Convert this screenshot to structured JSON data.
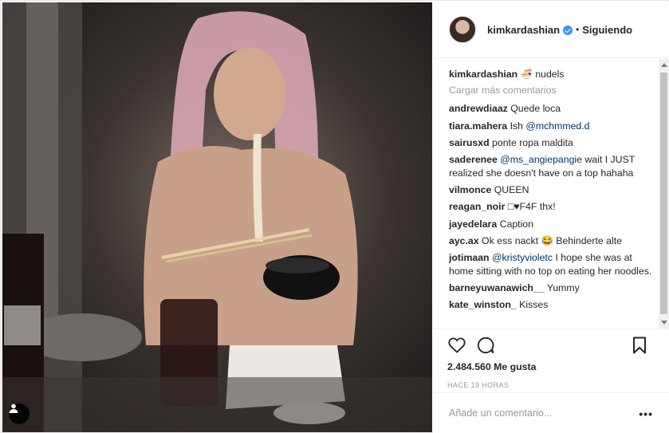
{
  "header": {
    "username": "kimkardashian",
    "verified": true,
    "separator": "•",
    "follow_label": "Siguiendo"
  },
  "caption": {
    "user": "kimkardashian",
    "text": "🍜 nudels"
  },
  "load_more_label": "Cargar más comentarios",
  "comments": [
    {
      "user": "andrewdiaaz",
      "text": "Quede loca"
    },
    {
      "user": "tiara.mahera",
      "text": "Ish ",
      "mention": "@mchmmed.d"
    },
    {
      "user": "sairusxd",
      "text": "ponte ropa maldita"
    },
    {
      "user": "saderenee",
      "mention_first": "@ms_angiepangie",
      "text": " wait I JUST realized she doesn't have on a top hahaha"
    },
    {
      "user": "vilmonce",
      "text": "QUEEN"
    },
    {
      "user": "reagan_noir",
      "text": "□♥F4F thx!"
    },
    {
      "user": "jayedelara",
      "text": "Caption"
    },
    {
      "user": "ayc.ax",
      "text": "Ok ess nackt 😂 Behinderte alte"
    },
    {
      "user": "jotimaan",
      "mention_first": "@kristyvioletc",
      "text": " I hope she was at home sitting with no top on eating her noodles."
    },
    {
      "user": "barneyuwanawich__",
      "text": "Yummy"
    },
    {
      "user": "kate_winston_",
      "text": "Kisses"
    }
  ],
  "actions": {
    "like_icon": "heart-icon",
    "comment_icon": "comment-bubble-icon",
    "save_icon": "bookmark-icon"
  },
  "likes_label": "2.484.560 Me gusta",
  "timestamp": "HACE 19 HORAS",
  "add_comment": {
    "placeholder": "Añade un comentario...",
    "more_label": "•••"
  },
  "colors": {
    "verified": "#3897f0",
    "mention": "#003569",
    "muted": "#999999",
    "border": "#efefef"
  }
}
